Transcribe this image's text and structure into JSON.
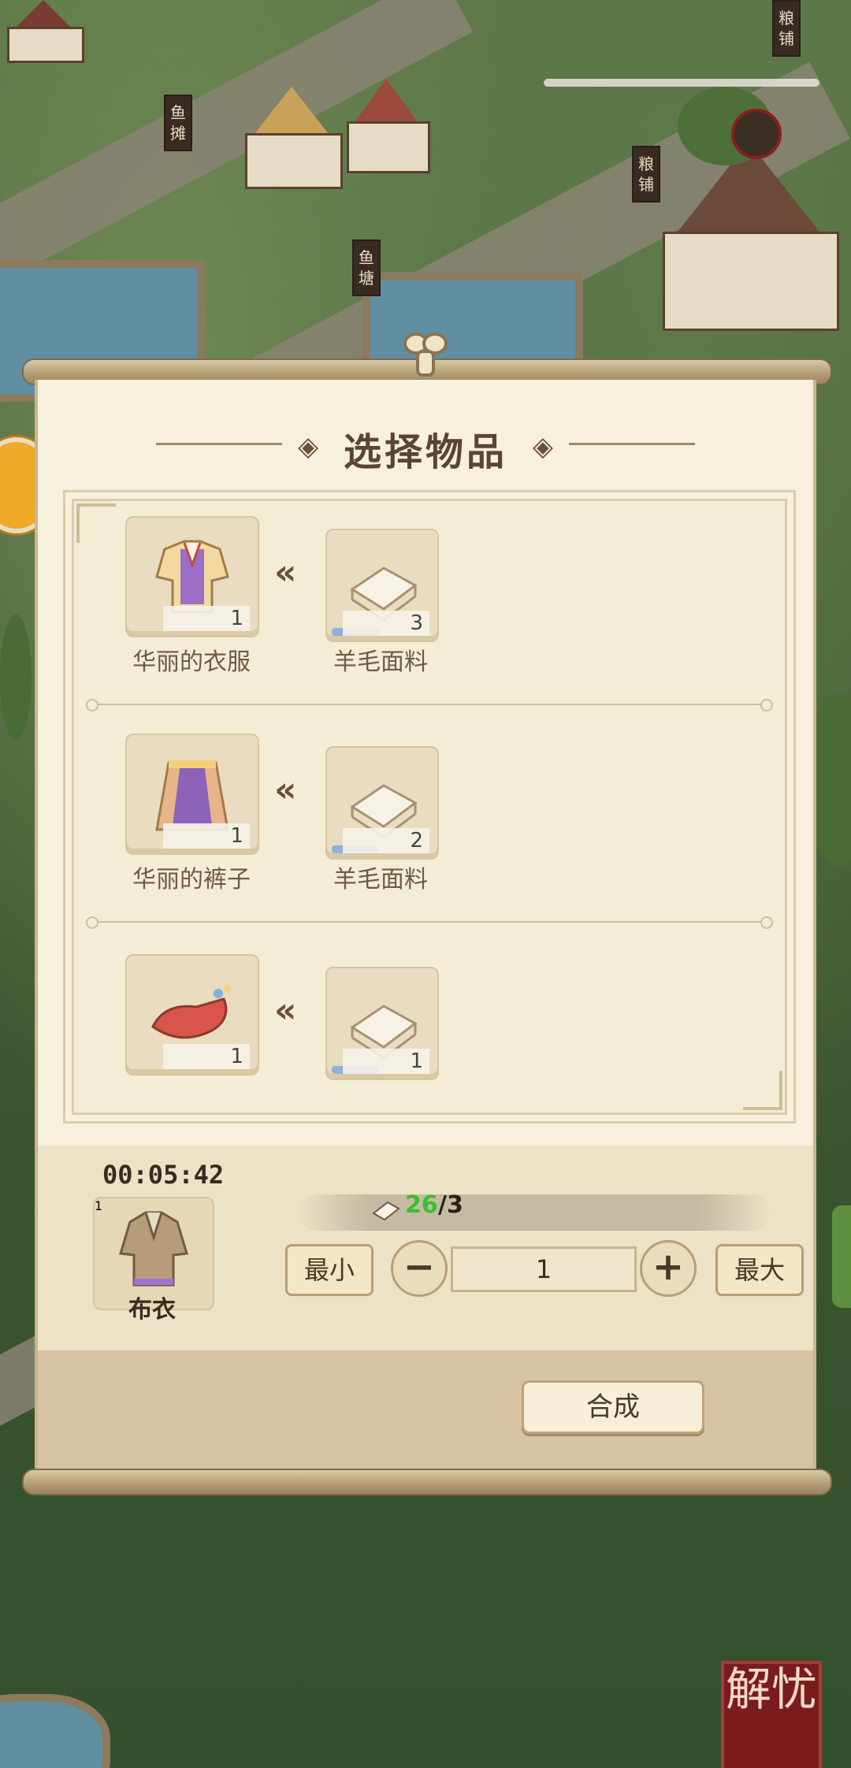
{
  "background": {
    "signs": [
      "鱼摊",
      "鱼塘",
      "粮铺",
      "粮铺"
    ],
    "corner_stamp": "解忧"
  },
  "dialog": {
    "title": "选择物品",
    "recipes": [
      {
        "product_name": "华丽的衣服",
        "product_qty": "1",
        "material_name": "羊毛面料",
        "material_qty": "3",
        "icon": "robe-icon"
      },
      {
        "product_name": "华丽的裤子",
        "product_qty": "1",
        "material_name": "羊毛面料",
        "material_qty": "2",
        "icon": "skirt-icon"
      },
      {
        "product_name": "",
        "product_qty": "1",
        "material_name": "",
        "material_qty": "1",
        "icon": "shoes-icon"
      }
    ],
    "craft": {
      "timer": "00:05:42",
      "product_name": "布衣",
      "product_qty": "1",
      "have": "26",
      "need": "/3",
      "btn_min": "最小",
      "btn_max": "最大",
      "minus": "−",
      "plus": "+",
      "quantity": "1"
    },
    "synthesize_label": "合成"
  },
  "colors": {
    "accent_green": "#39c12b",
    "panel_bg": "#f6f0dc",
    "text_brown": "#6f5a44"
  }
}
